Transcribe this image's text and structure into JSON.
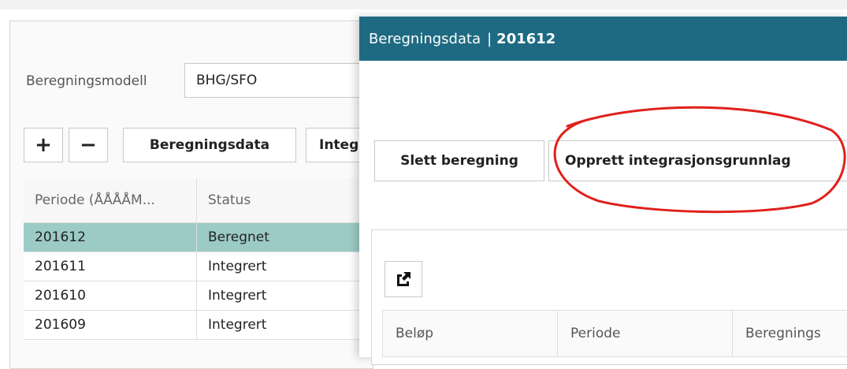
{
  "background": {
    "model_label": "Beregningsmodell",
    "model_value": "BHG/SFO",
    "toolbar": {
      "add_label": "+",
      "remove_label": "−",
      "calc_data_label": "Beregningsdata",
      "integ_label": "Integ"
    },
    "grid": {
      "headers": [
        "Periode (ÅÅÅÅM...",
        "Status"
      ],
      "rows": [
        {
          "period": "201612",
          "status": "Beregnet",
          "selected": true
        },
        {
          "period": "201611",
          "status": "Integrert"
        },
        {
          "period": "201610",
          "status": "Integrert"
        },
        {
          "period": "201609",
          "status": "Integrert"
        }
      ]
    }
  },
  "modal": {
    "title": "Beregningsdata",
    "separator": "|",
    "title_period": "201612",
    "header_color": "#1e6a82",
    "buttons": {
      "delete_label": "Slett beregning",
      "create_label": "Opprett integrasjonsgrunnlag"
    },
    "export_icon": "export-icon",
    "grid_headers": [
      "Beløp",
      "Periode",
      "Beregnings"
    ]
  },
  "colors": {
    "selected_row": "#9ccbc6",
    "annotation": "#e0201b"
  }
}
